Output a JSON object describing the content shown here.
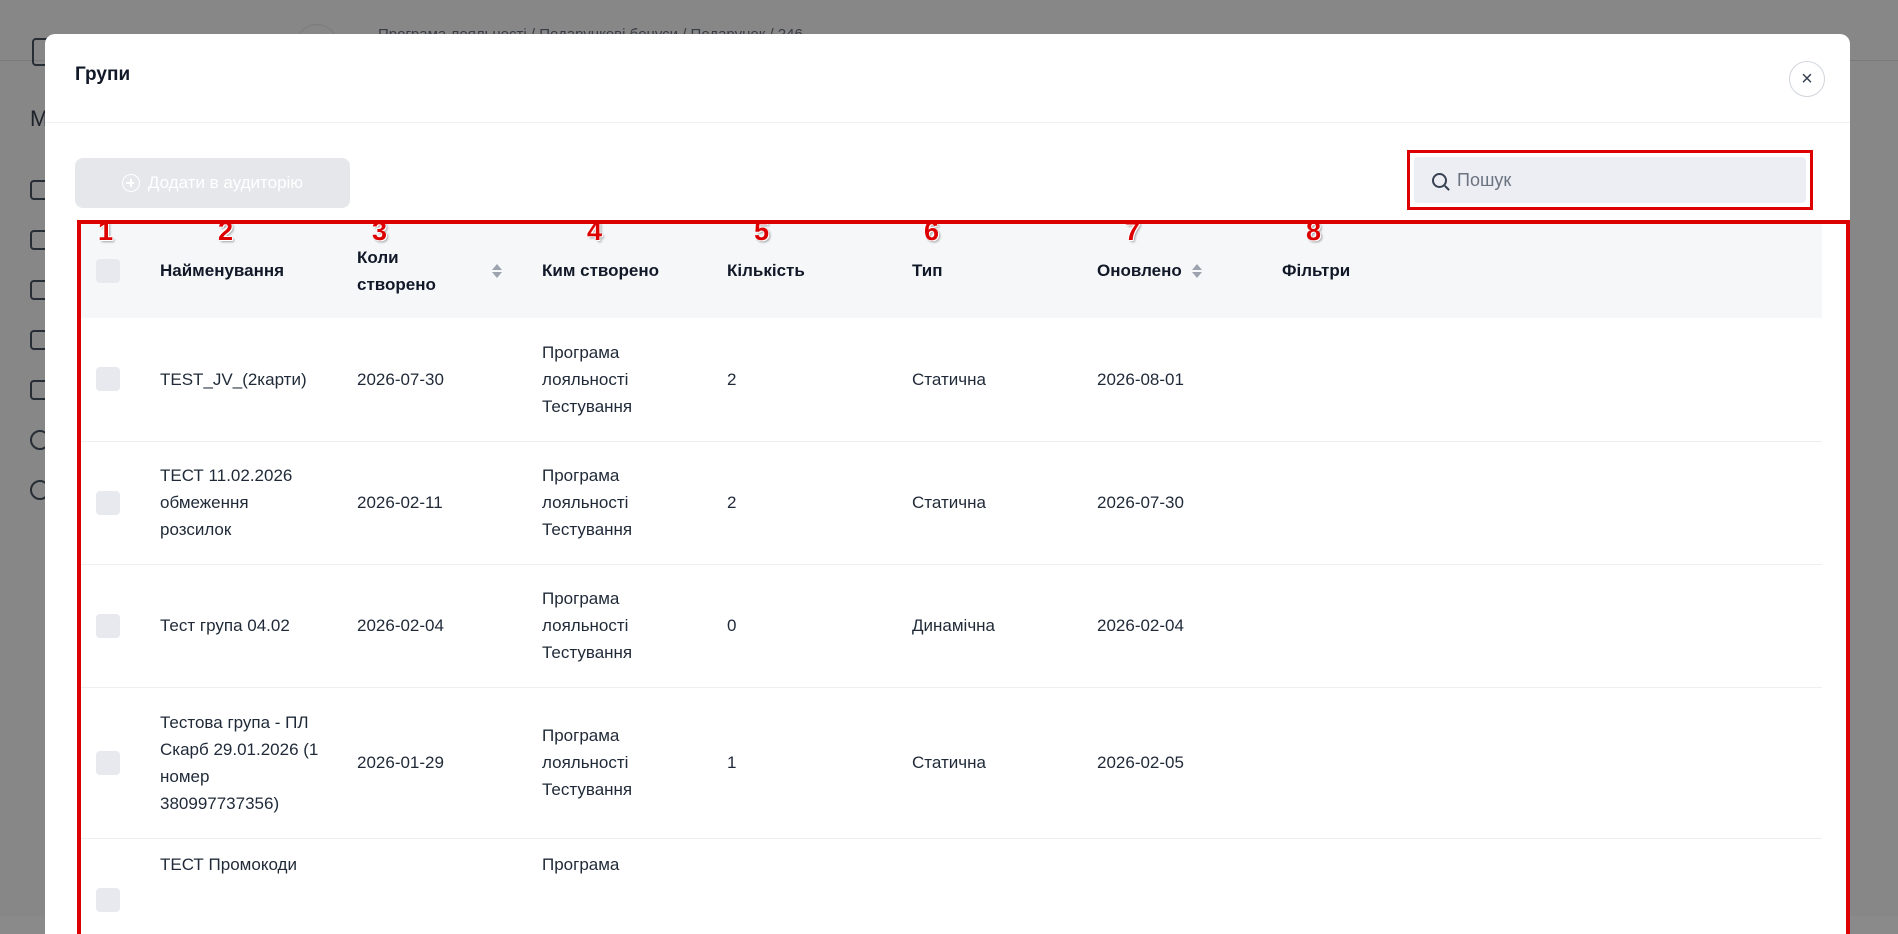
{
  "background": {
    "breadcrumb": "Програма лояльності / Подарункові бонуси / Подарунок / 246",
    "sidebar_letter": "М"
  },
  "modal": {
    "title": "Групи",
    "close_icon": "×",
    "add_button_label": "Додати в аудиторію",
    "search_placeholder": "Пошук"
  },
  "annotations": [
    "1",
    "2",
    "3",
    "4",
    "5",
    "6",
    "7",
    "8"
  ],
  "table": {
    "columns": [
      {
        "label": ""
      },
      {
        "label": "Найменування"
      },
      {
        "label": "Коли створено",
        "sortable": true
      },
      {
        "label": "Ким створено"
      },
      {
        "label": "Кількість"
      },
      {
        "label": "Тип"
      },
      {
        "label": "Оновлено",
        "sortable": true
      },
      {
        "label": "Фільтри"
      }
    ],
    "rows": [
      {
        "name": "TEST_JV_(2карти)",
        "created": "2026-07-30",
        "created_by": "Програма лояльності Тестування",
        "count": "2",
        "type": "Статична",
        "updated": "2026-08-01",
        "filters": ""
      },
      {
        "name": "ТЕСТ 11.02.2026 обмеження розсилок",
        "created": "2026-02-11",
        "created_by": "Програма лояльності Тестування",
        "count": "2",
        "type": "Статична",
        "updated": "2026-07-30",
        "filters": ""
      },
      {
        "name": "Тест група 04.02",
        "created": "2026-02-04",
        "created_by": "Програма лояльності Тестування",
        "count": "0",
        "type": "Динамічна",
        "updated": "2026-02-04",
        "filters": ""
      },
      {
        "name": "Тестова група - ПЛ Скарб 29.01.2026 (1 номер 380997737356)",
        "created": "2026-01-29",
        "created_by": "Програма лояльності Тестування",
        "count": "1",
        "type": "Статична",
        "updated": "2026-02-05",
        "filters": ""
      },
      {
        "name": "ТЕСТ Промокоди",
        "created": "",
        "created_by": "Програма",
        "count": "",
        "type": "",
        "updated": "",
        "filters": ""
      }
    ]
  },
  "colors": {
    "highlight": "#dd0000",
    "disabled_button": "#e5e7eb",
    "header_bg": "#f6f7f9"
  }
}
